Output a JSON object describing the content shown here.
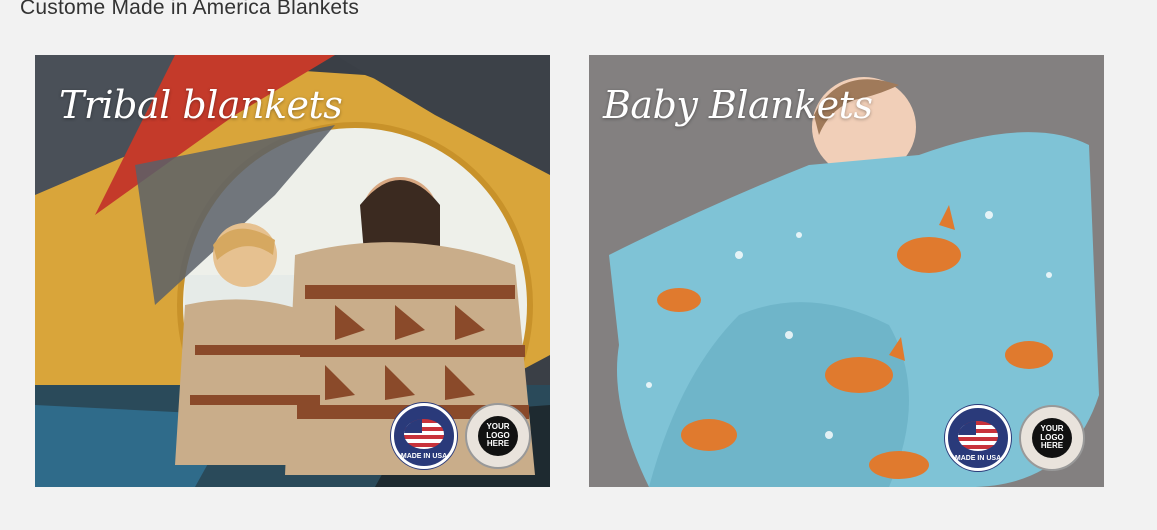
{
  "page": {
    "heading": "Custome Made in America Blankets"
  },
  "cards": [
    {
      "title": "Tribal blankets",
      "badges": {
        "usa": "MADE IN USA",
        "logo": "YOUR LOGO HERE"
      }
    },
    {
      "title": "Baby Blankets",
      "badges": {
        "usa": "MADE IN USA",
        "logo": "YOUR LOGO HERE"
      }
    }
  ],
  "colors": {
    "background": "#f2f2f2",
    "tent_yellow": "#d9a53a",
    "tent_gray": "#4a5058",
    "blanket_tan": "#c9ad8a",
    "blanket_rust": "#8a4a2a",
    "baby_blue": "#7fc3d6",
    "fur_gray": "#7d7a7a",
    "fox_orange": "#e07a2e"
  }
}
